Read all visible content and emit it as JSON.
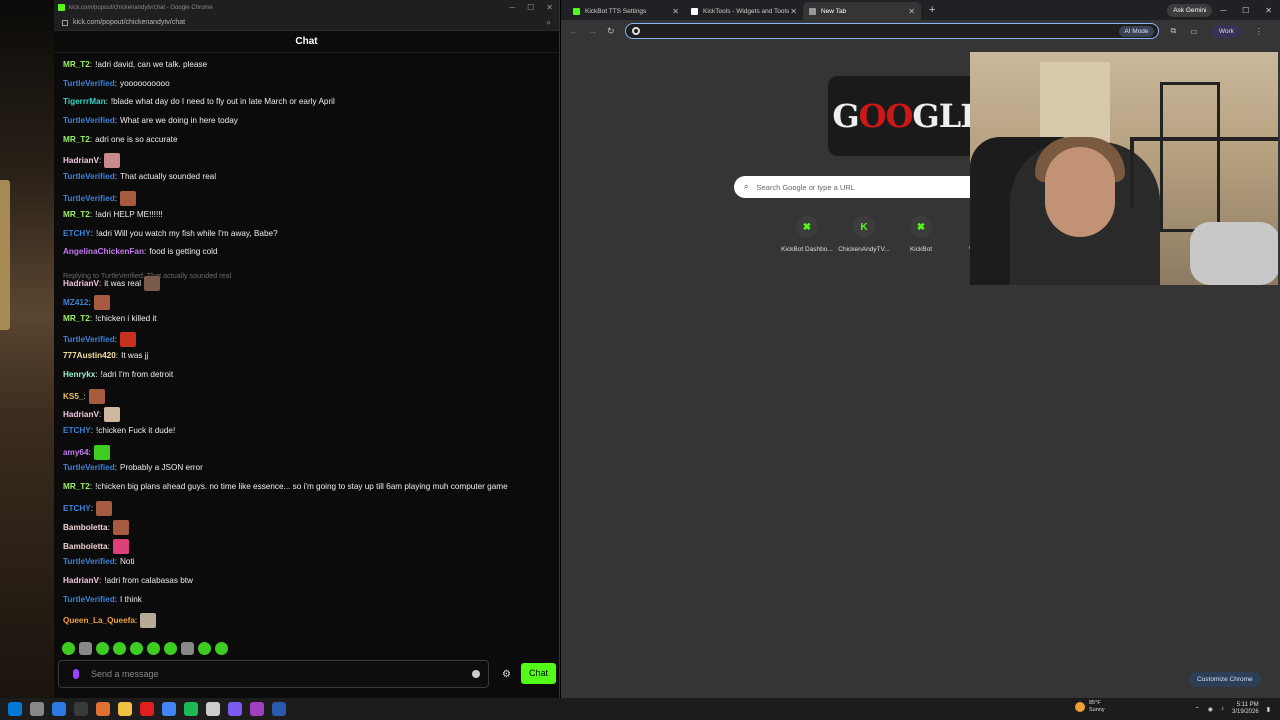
{
  "chat_window": {
    "title": "kick.com/popout/chickenandytv/chat - Google Chrome",
    "url": "kick.com/popout/chickenandytv/chat",
    "header": "Chat",
    "reply_text": "Replying to TurtleVerified: That actually sounded real",
    "messages": [
      {
        "user": "MR_T2",
        "color": "#9cf06a",
        "text": "!adri david, can we talk. please",
        "emote": ""
      },
      {
        "user": "TurtleVerified",
        "color": "#3b82d6",
        "text": "yoooooooooo",
        "emote": ""
      },
      {
        "user": "TigerrrMan",
        "color": "#38d2c8",
        "text": "!blade what day do I need to fly out in late March or early April",
        "emote": ""
      },
      {
        "user": "TurtleVerified",
        "color": "#3b82d6",
        "text": "What are we doing in here today",
        "emote": ""
      },
      {
        "user": "MR_T2",
        "color": "#9cf06a",
        "text": "adri one is so accurate",
        "emote": ""
      },
      {
        "user": "HadrianV",
        "color": "#f0c8e0",
        "text": "",
        "emote": "#c98a8a"
      },
      {
        "user": "TurtleVerified",
        "color": "#3b82d6",
        "text": "That actually sounded real",
        "emote": ""
      },
      {
        "user": "TurtleVerified",
        "color": "#3b82d6",
        "text": "",
        "emote": "#a65a40"
      },
      {
        "user": "MR_T2",
        "color": "#9cf06a",
        "text": "!adri HELP ME!!!!!!",
        "emote": ""
      },
      {
        "user": "ETCHY",
        "color": "#3b82d6",
        "text": "!adri Will you watch my fish while I'm away, Babe?",
        "emote": ""
      },
      {
        "user": "AngelinaChickenFan",
        "color": "#c57af0",
        "text": "food is getting cold",
        "emote": ""
      },
      {
        "user": "HadrianV",
        "color": "#f0c8e0",
        "text": "it was real",
        "emote": "#7a5a4a"
      },
      {
        "user": "MZ412",
        "color": "#3b82d6",
        "text": "",
        "emote": "#a65a40"
      },
      {
        "user": "MR_T2",
        "color": "#9cf06a",
        "text": "!chicken i killed it",
        "emote": ""
      },
      {
        "user": "TurtleVerified",
        "color": "#3b82d6",
        "text": "",
        "emote": "#c83020"
      },
      {
        "user": "777Austin420",
        "color": "#f0e0a0",
        "text": "It was jj",
        "emote": ""
      },
      {
        "user": "Henrykx",
        "color": "#9cf0d0",
        "text": "!adri I'm from detroit",
        "emote": ""
      },
      {
        "user": "KS5_",
        "color": "#f0c060",
        "text": "",
        "emote": "#a65a40"
      },
      {
        "user": "HadrianV",
        "color": "#f0c8e0",
        "text": "",
        "emote": "#d0b8a0"
      },
      {
        "user": "ETCHY",
        "color": "#3b82d6",
        "text": "!chicken Fuck it dude!",
        "emote": ""
      },
      {
        "user": "amy64",
        "color": "#c57af0",
        "text": "",
        "emote": "#3dcc20"
      },
      {
        "user": "TurtleVerified",
        "color": "#3b82d6",
        "text": "Probably a JSON error",
        "emote": ""
      },
      {
        "user": "MR_T2",
        "color": "#9cf06a",
        "text": "!chicken big plans ahead guys. no time like essence... so i'm going to stay up till 6am playing muh computer game",
        "emote": ""
      },
      {
        "user": "ETCHY",
        "color": "#3b82d6",
        "text": "",
        "emote": "#a65a40"
      },
      {
        "user": "Bamboletta",
        "color": "#f0d0d0",
        "text": "",
        "emote": "#a65a40"
      },
      {
        "user": "Bamboletta",
        "color": "#f0d0d0",
        "text": "",
        "emote": "#e0407a"
      },
      {
        "user": "TurtleVerified",
        "color": "#3b82d6",
        "text": "Noti",
        "emote": ""
      },
      {
        "user": "HadrianV",
        "color": "#f0c8e0",
        "text": "!adri from calabasas btw",
        "emote": ""
      },
      {
        "user": "TurtleVerified",
        "color": "#3b82d6",
        "text": "I think",
        "emote": ""
      },
      {
        "user": "Queen_La_Queefa",
        "color": "#f0a040",
        "text": "",
        "emote": "#b8a898"
      }
    ],
    "input_placeholder": "Send a message",
    "send_label": "Chat"
  },
  "browser": {
    "tabs": [
      {
        "label": "KickBot TTS Settings",
        "fav": "#53fc18"
      },
      {
        "label": "KickTools - Widgets and Tools",
        "fav": "#ffffff"
      },
      {
        "label": "New Tab",
        "fav": "#999999"
      }
    ],
    "ask_gemini": "Ask Gemini",
    "ai_mode": "AI Mode",
    "profile": "Work",
    "doodle_left": "G",
    "doodle_red": "OO",
    "doodle_right": "GLE",
    "search_placeholder": "Search Google or type a URL",
    "shortcuts": [
      {
        "label": "KickBot Dashbo...",
        "glyph": "✖"
      },
      {
        "label": "ChickenAndyTV...",
        "glyph": "K"
      },
      {
        "label": "KickBot",
        "glyph": "✖"
      },
      {
        "label": "We",
        "glyph": ""
      }
    ],
    "customize": "Customize Chrome"
  },
  "taskbar": {
    "temp": "85°F",
    "weather": "Sunny",
    "time": "5:11 PM",
    "date": "3/19/2026",
    "apps": [
      "#0078d4",
      "#888888",
      "#2a7ae2",
      "#3a3a3a",
      "#e07030",
      "#f0c040",
      "#e02020",
      "#4285f4",
      "#1db954",
      "#cccccc",
      "#7a5af0",
      "#a040c0",
      "#2a5ab0"
    ]
  }
}
